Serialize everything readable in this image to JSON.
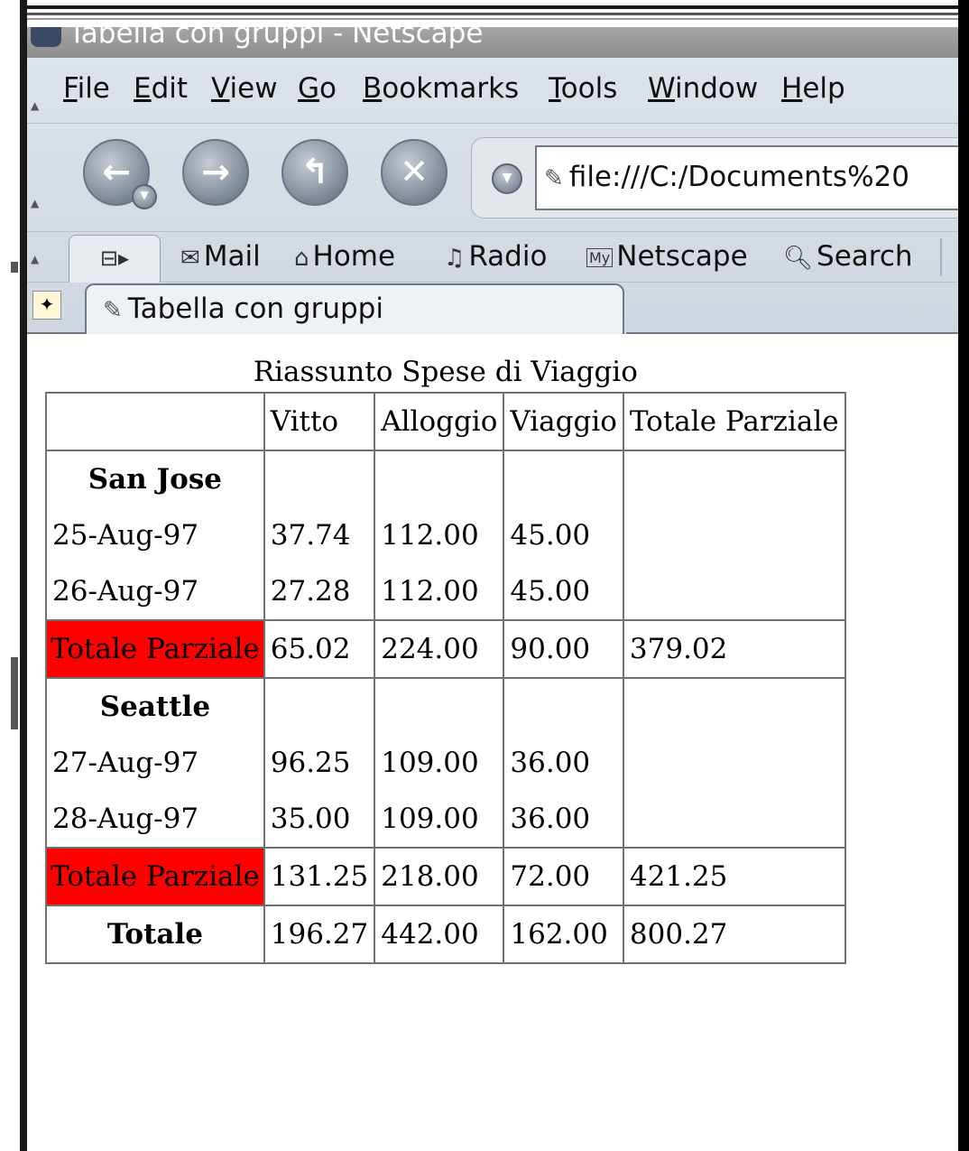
{
  "window": {
    "title": "Tabella con gruppi - Netscape"
  },
  "menubar": {
    "items": [
      {
        "prefix": "",
        "u": "F",
        "rest": "ile"
      },
      {
        "prefix": "",
        "u": "E",
        "rest": "dit"
      },
      {
        "prefix": "",
        "u": "V",
        "rest": "iew"
      },
      {
        "prefix": "",
        "u": "G",
        "rest": "o"
      },
      {
        "prefix": "",
        "u": "B",
        "rest": "ookmarks"
      },
      {
        "prefix": "",
        "u": "T",
        "rest": "ools"
      },
      {
        "prefix": "",
        "u": "W",
        "rest": "indow"
      },
      {
        "prefix": "",
        "u": "H",
        "rest": "elp"
      }
    ]
  },
  "navbar": {
    "url": "file:///C:/Documents%20"
  },
  "personal_toolbar": {
    "mail": "Mail",
    "home": "Home",
    "radio": "Radio",
    "my_netscape": "Netscape",
    "search": "Search"
  },
  "tabs": {
    "active_label": "Tabella con gruppi"
  },
  "table": {
    "caption": "Riassunto Spese di Viaggio",
    "headers": [
      "",
      "Vitto",
      "Alloggio",
      "Viaggio",
      "Totale Parziale"
    ],
    "groups": [
      {
        "name": "San Jose",
        "rows": [
          [
            "25-Aug-97",
            "37.74",
            "112.00",
            "45.00"
          ],
          [
            "26-Aug-97",
            "27.28",
            "112.00",
            "45.00"
          ]
        ],
        "subtotal": [
          "Totale Parziale",
          "65.02",
          "224.00",
          "90.00",
          "379.02"
        ]
      },
      {
        "name": "Seattle",
        "rows": [
          [
            "27-Aug-97",
            "96.25",
            "109.00",
            "36.00"
          ],
          [
            "28-Aug-97",
            "35.00",
            "109.00",
            "36.00"
          ]
        ],
        "subtotal": [
          "Totale Parziale",
          "131.25",
          "218.00",
          "72.00",
          "421.25"
        ]
      }
    ],
    "total": [
      "Totale",
      "196.27",
      "442.00",
      "162.00",
      "800.27"
    ]
  },
  "colors": {
    "subtotal_highlight": "#ff0000"
  }
}
